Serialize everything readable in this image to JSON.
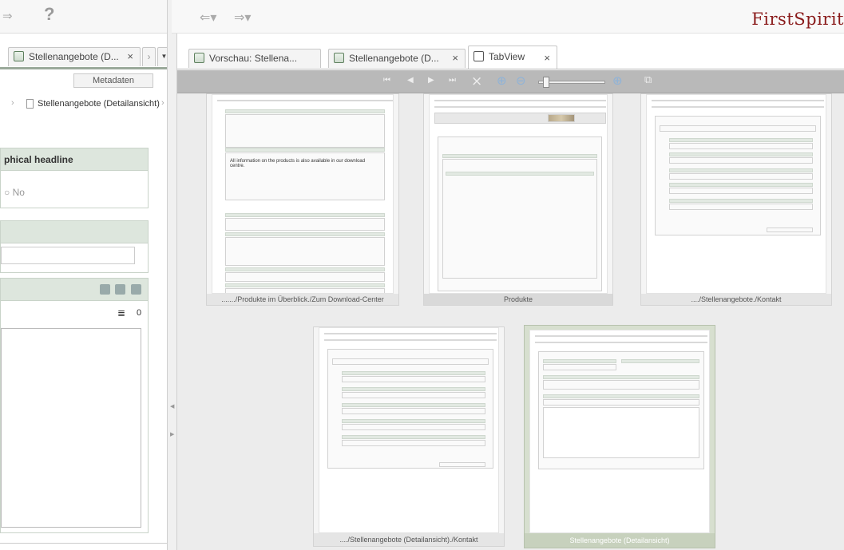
{
  "app": {
    "logo": "FirstSpirit"
  },
  "left_panel": {
    "tab_label": "Stellenangebote (D...",
    "metadata_button": "Metadaten",
    "tree_item": "Stellenangebote (Detailansicht)",
    "sec1_header": "phical headline",
    "sec1_value": "No",
    "counter": "0"
  },
  "tabs": [
    {
      "label": "Vorschau: Stellena..."
    },
    {
      "label": "Stellenangebote (D..."
    },
    {
      "label": "TabView"
    }
  ],
  "thumbnails": [
    {
      "caption": "......./Produkte im Überblick./Zum Download-Center",
      "text": "All information on the products is also available in our download centre."
    },
    {
      "caption": "Produkte",
      "text": ""
    },
    {
      "caption": "..../Stellenangebote./Kontakt",
      "text": ""
    },
    {
      "caption": "..../Stellenangebote (Detailansicht)./Kontakt",
      "text": ""
    },
    {
      "caption": "Stellenangebote (Detailansicht)",
      "text": ""
    }
  ],
  "icons": {
    "help": "?",
    "close": "×",
    "first": "⏮",
    "prev": "◀",
    "next": "▶",
    "last": "⏭",
    "zoom": "zoom-icon"
  }
}
